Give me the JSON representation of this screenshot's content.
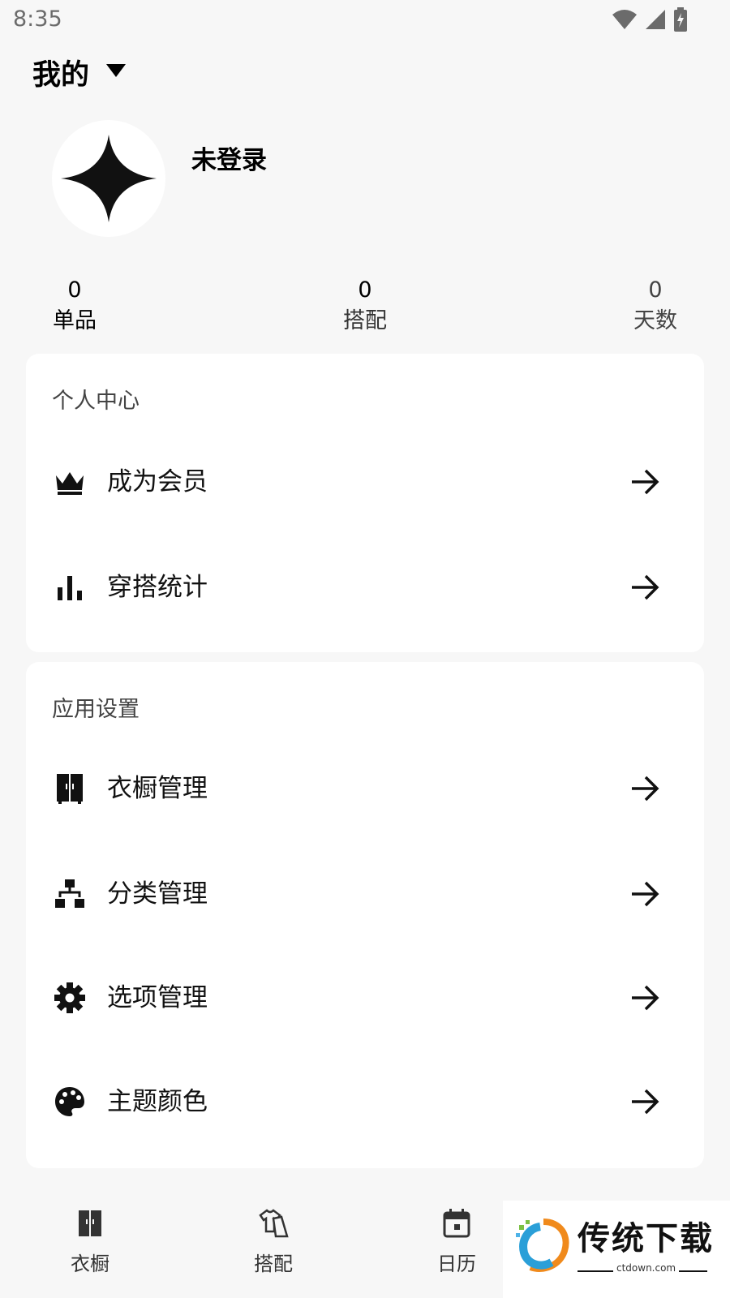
{
  "status_bar": {
    "time": "8:35"
  },
  "header": {
    "title": "我的"
  },
  "profile": {
    "name": "未登录"
  },
  "stats": [
    {
      "value": "0",
      "label": "单品"
    },
    {
      "value": "0",
      "label": "搭配"
    },
    {
      "value": "0",
      "label": "天数"
    }
  ],
  "sections": {
    "personal": {
      "title": "个人中心",
      "items": [
        {
          "label": "成为会员",
          "icon": "crown-icon"
        },
        {
          "label": "穿搭统计",
          "icon": "bar-chart-icon"
        }
      ]
    },
    "settings": {
      "title": "应用设置",
      "items": [
        {
          "label": "衣橱管理",
          "icon": "wardrobe-icon"
        },
        {
          "label": "分类管理",
          "icon": "hierarchy-icon"
        },
        {
          "label": "选项管理",
          "icon": "gear-icon"
        },
        {
          "label": "主题颜色",
          "icon": "palette-icon"
        }
      ]
    }
  },
  "bottom_nav": [
    {
      "label": "衣橱",
      "icon": "wardrobe-icon"
    },
    {
      "label": "搭配",
      "icon": "shirt-icon"
    },
    {
      "label": "日历",
      "icon": "calendar-icon"
    }
  ],
  "watermark": {
    "brand": "传统下载",
    "url": "ctdown.com"
  }
}
